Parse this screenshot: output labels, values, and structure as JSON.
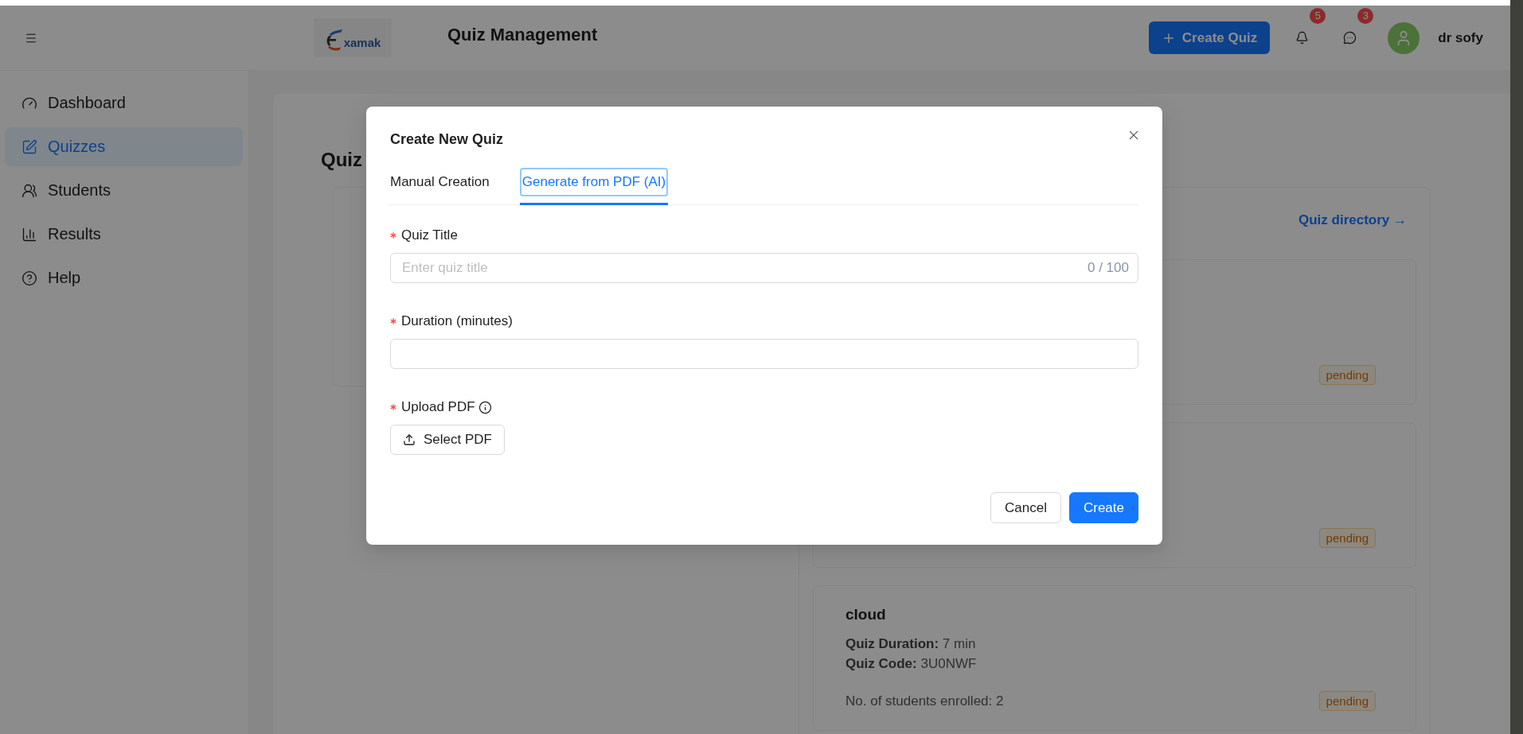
{
  "header": {
    "logo": "xamak",
    "title": "Quiz Management",
    "create_button": "Create Quiz",
    "notifications": {
      "count": "5"
    },
    "messages": {
      "count": "3"
    },
    "user": {
      "name": "dr sofy"
    }
  },
  "sidebar": {
    "items": [
      {
        "label": "Dashboard",
        "selected": false
      },
      {
        "label": "Quizzes",
        "selected": true
      },
      {
        "label": "Students",
        "selected": false
      },
      {
        "label": "Results",
        "selected": false
      },
      {
        "label": "Help",
        "selected": false
      }
    ]
  },
  "page": {
    "heading": "Quiz",
    "directory_link": "Quiz directory →",
    "quiz_cards": [
      {
        "status": "pending"
      },
      {
        "status": "pending"
      },
      {
        "title": "cloud",
        "details": [
          "**Quiz Duration:** 7 min",
          "**Quiz Code:** 3U0NWF"
        ],
        "enrolled": "No. of students enrolled: 2",
        "status": "pending"
      }
    ]
  },
  "modal": {
    "title": "Create New Quiz",
    "tabs": [
      {
        "label": "Manual Creation",
        "selected": false,
        "focused": false
      },
      {
        "label": "Generate from PDF (AI)",
        "selected": true,
        "focused": true
      }
    ],
    "fields": [
      {
        "kind": "text",
        "label": "Quiz Title",
        "required": true,
        "placeholder": "Enter quiz title",
        "count": "0 / 100"
      },
      {
        "kind": "text",
        "label": "Duration (minutes)",
        "required": true
      },
      {
        "kind": "upload",
        "label": "Upload PDF",
        "required": true,
        "info": true,
        "button": "Select PDF"
      }
    ],
    "buttons": [
      {
        "label": "Cancel",
        "primary": false
      },
      {
        "label": "Create",
        "primary": true
      }
    ]
  }
}
